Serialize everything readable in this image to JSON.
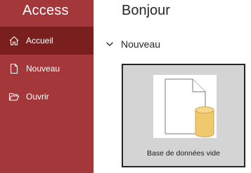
{
  "sidebar": {
    "app_name": "Access",
    "items": [
      {
        "label": "Accueil",
        "icon": "home-icon"
      },
      {
        "label": "Nouveau",
        "icon": "new-document-icon"
      },
      {
        "label": "Ouvrir",
        "icon": "folder-open-icon"
      }
    ]
  },
  "main": {
    "greeting": "Bonjour",
    "section_title": "Nouveau",
    "template": {
      "caption": "Base de données vide",
      "icon": "blank-database-icon"
    }
  },
  "colors": {
    "sidebar_bg": "#a4373a",
    "sidebar_active_bg": "#7a1f1d",
    "tile_bg": "#d4d4d4",
    "tile_border": "#262626",
    "database_gold": "#f0c96d"
  }
}
